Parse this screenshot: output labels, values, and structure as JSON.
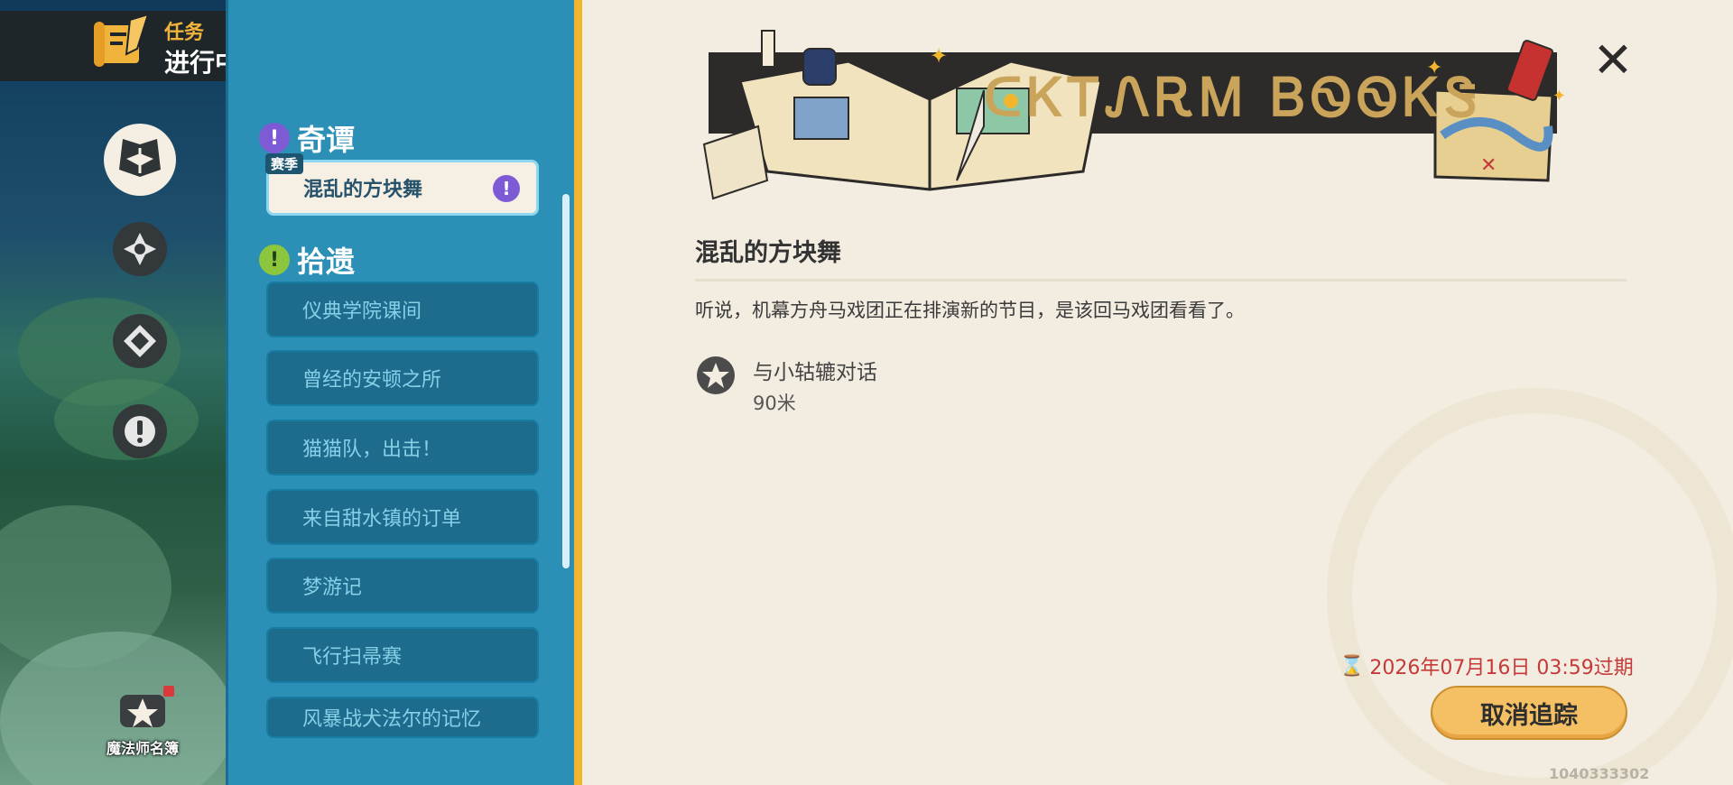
{
  "header": {
    "category": "任务",
    "status": "进行中"
  },
  "sidebar": {
    "roster_label": "魔法师名簿"
  },
  "list": {
    "section_wonder": "奇谭",
    "season_tag": "赛季",
    "selected_item": "混乱的方块舞",
    "section_lost": "拾遗",
    "items": [
      "仪典学院课间",
      "曾经的安顿之所",
      "猫猫队，出击！",
      "来自甜水镇的订单",
      "梦游记",
      "飞行扫帚赛",
      "风暴战犬法尔的记忆"
    ]
  },
  "detail": {
    "banner_text": "ᑕᏦᎢᏁᎡᎷ ᏴᏫᏫᏦᏕ",
    "title": "混乱的方块舞",
    "description": "听说，机幕方舟马戏团正在排演新的节目，是该回马戏团看看了。",
    "objective": {
      "task": "与小轱辘对话",
      "distance": "90米"
    },
    "expiry": "2026年07月16日 03:59过期",
    "track_button": "取消追踪",
    "uid": "1040333302"
  },
  "colors": {
    "accent": "#f2b52e",
    "panel": "#2b8fb6",
    "expiry": "#c53939"
  }
}
